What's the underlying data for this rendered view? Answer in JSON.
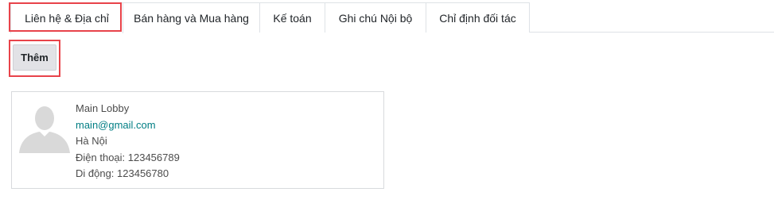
{
  "tabs": [
    {
      "label": "Liên hệ & Địa chỉ",
      "active": true
    },
    {
      "label": "Bán hàng và Mua hàng",
      "active": false
    },
    {
      "label": "Kế toán",
      "active": false
    },
    {
      "label": "Ghi chú Nội bộ",
      "active": false
    },
    {
      "label": "Chỉ định đối tác",
      "active": false
    }
  ],
  "add_button": {
    "label": "Thêm"
  },
  "contact_card": {
    "name": "Main Lobby",
    "email": "main@gmail.com",
    "city": "Hà Nội",
    "phone": "Điện thoại: 123456789",
    "mobile": "Di động: 123456780",
    "avatar_icon": "person-silhouette-icon"
  },
  "colors": {
    "highlight": "#e8434a",
    "email_link": "#017e84",
    "button_bg": "#e2e2e6"
  }
}
